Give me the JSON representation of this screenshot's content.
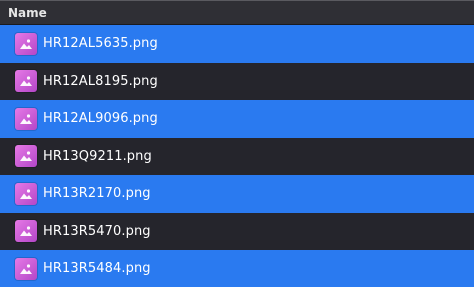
{
  "header": {
    "name_label": "Name"
  },
  "files": [
    {
      "name": "HR12AL5635.png",
      "selected": true
    },
    {
      "name": "HR12AL8195.png",
      "selected": false
    },
    {
      "name": "HR12AL9096.png",
      "selected": true
    },
    {
      "name": "HR13Q9211.png",
      "selected": false
    },
    {
      "name": "HR13R2170.png",
      "selected": true
    },
    {
      "name": "HR13R5470.png",
      "selected": false
    },
    {
      "name": "HR13R5484.png",
      "selected": true
    }
  ],
  "icons": {
    "file_icon": "image-file-icon"
  },
  "colors": {
    "selected_row": "#2a7af0",
    "unselected_row": "#25252c",
    "header": "#2f2f35"
  }
}
